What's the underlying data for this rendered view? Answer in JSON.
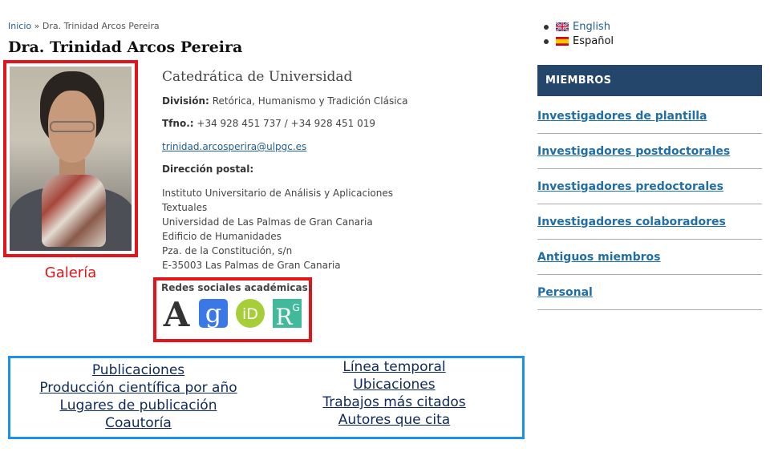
{
  "breadcrumb": {
    "home": "Inicio",
    "separator": " » ",
    "current": "Dra. Trinidad Arcos Pereira"
  },
  "profile": {
    "name": "Dra. Trinidad Arcos Pereira",
    "position": "Catedrática de Universidad",
    "division_label": "División:",
    "division_value": "Retórica, Humanismo y Tradición Clásica",
    "phone_label": "Tfno.:",
    "phone_value": "+34 928 451 737 / +34 928 451 019",
    "email": "trinidad.arcosperira@ulpgc.es",
    "postal_label": "Dirección postal:",
    "address": [
      "Instituto Universitario de Análisis y Aplicaciones",
      "Textuales",
      "Universidad de Las Palmas de Gran Canaria",
      "Edificio de Humanidades",
      "Pza. de la Constitución, s/n",
      "E-35003 Las Palmas de Gran Canaria"
    ],
    "gallery_label": "Galería"
  },
  "social": {
    "label": "Redes sociales académicas:",
    "icons": [
      {
        "name": "academia-icon",
        "glyph": "A",
        "color": "#333333"
      },
      {
        "name": "google-scholar-icon",
        "glyph": "g",
        "color": "#3b78e7"
      },
      {
        "name": "orcid-icon",
        "glyph": "iD",
        "color": "#a6ce39"
      },
      {
        "name": "researchgate-icon",
        "glyph": "R",
        "sup": "G",
        "color": "#40ba9b"
      }
    ]
  },
  "links": {
    "left": [
      "Publicaciones",
      "Producción científica por año",
      "Lugares de publicación",
      "Coautoría"
    ],
    "right": [
      "Línea temporal",
      "Ubicaciones",
      "Trabajos más citados",
      "Autores que cita"
    ]
  },
  "languages": [
    {
      "label": "English",
      "flag": "uk-flag-icon"
    },
    {
      "label": "Español",
      "flag": "spain-flag-icon"
    }
  ],
  "sidebar": {
    "title": "MIEMBROS",
    "items": [
      "Investigadores de plantilla",
      "Investigadores postdoctorales",
      "Investigadores predoctorales",
      "Investigadores colaboradores",
      "Antiguos miembros",
      "Personal"
    ]
  },
  "colors": {
    "accent_red": "#e3151a",
    "accent_blue": "#1e90e8",
    "sidebar_header": "#24466b",
    "link": "#1f6ea8"
  }
}
